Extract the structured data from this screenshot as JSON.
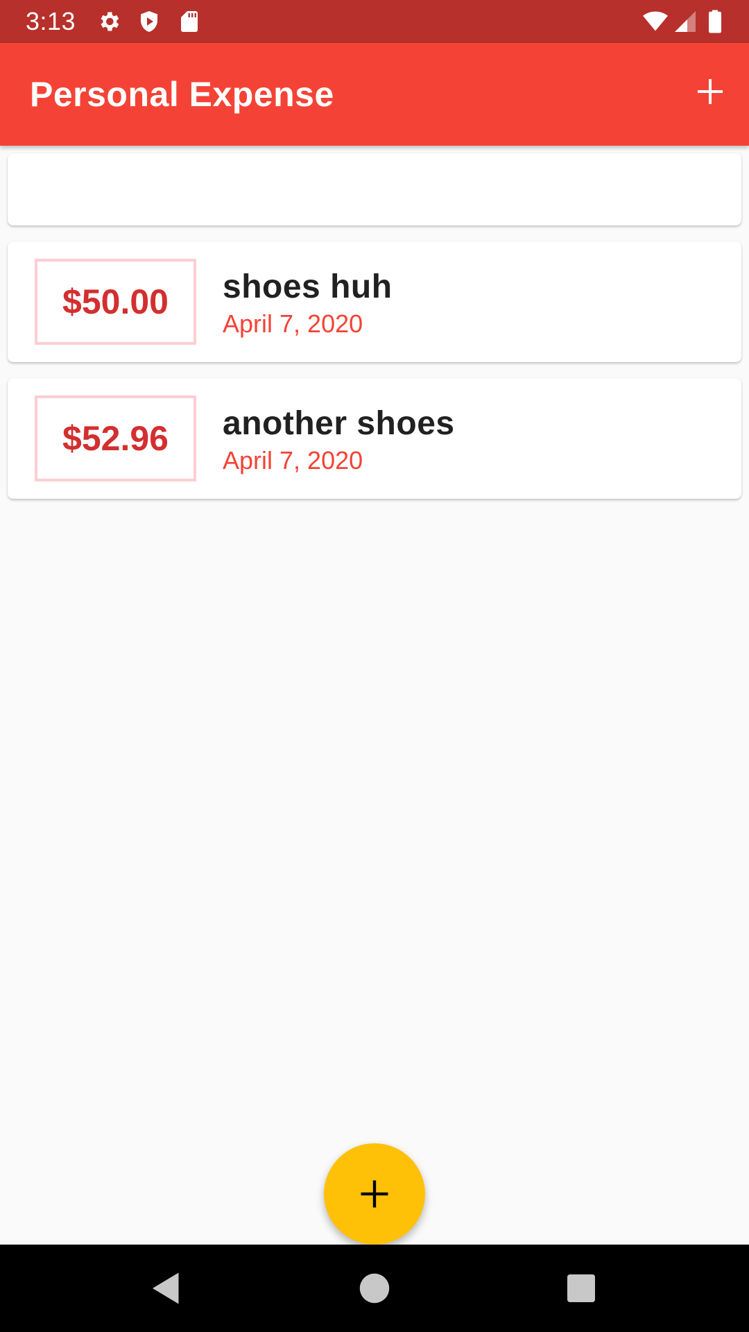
{
  "status_bar": {
    "time": "3:13",
    "left_icons": [
      "settings-icon",
      "shield-icon",
      "sd-card-icon"
    ],
    "right_icons": [
      "wifi-icon",
      "signal-icon",
      "battery-icon"
    ],
    "color": "#b7302b"
  },
  "app_bar": {
    "title": "Personal Expense",
    "action_icon": "add-icon",
    "color": "#f44336"
  },
  "chart": {
    "bars": []
  },
  "transactions": [
    {
      "amount": "$50.00",
      "title": "shoes huh",
      "date": "April 7, 2020"
    },
    {
      "amount": "$52.96",
      "title": "another shoes",
      "date": "April 7, 2020"
    }
  ],
  "fab": {
    "icon": "add-icon",
    "color": "#ffc107"
  },
  "nav_bar": {
    "buttons": [
      "back-icon",
      "home-icon",
      "recents-icon"
    ]
  },
  "colors": {
    "accent": "#ffc107",
    "primary": "#f44336",
    "amount_text": "#d32f2f",
    "amount_border": "#ffcdd2"
  }
}
